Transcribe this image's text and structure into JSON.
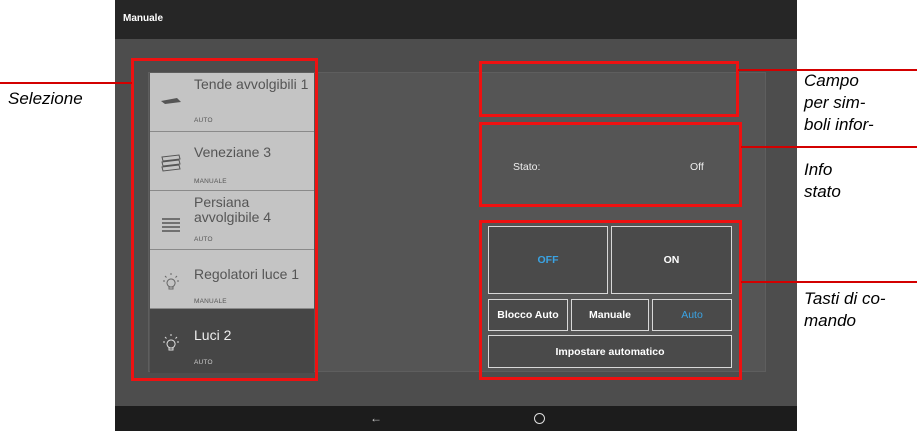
{
  "window": {
    "title": "Manuale"
  },
  "list": {
    "items": [
      {
        "label": "Tende avvolgibili 1",
        "mode": "AUTO",
        "icon": "awning-icon",
        "selected": false
      },
      {
        "label": "Veneziane 3",
        "mode": "MANUALE",
        "icon": "venetian-blind-icon",
        "selected": false
      },
      {
        "label": "Persiana avvolgibile 4",
        "mode": "AUTO",
        "icon": "roller-shutter-icon",
        "selected": false
      },
      {
        "label": "Regolatori luce 1",
        "mode": "MANUALE",
        "icon": "light-bulb-icon",
        "selected": false
      },
      {
        "label": "Luci 2",
        "mode": "AUTO",
        "icon": "light-bulb-icon",
        "selected": true
      }
    ]
  },
  "status": {
    "label": "Stato:",
    "value": "Off"
  },
  "buttons": {
    "off": "OFF",
    "on": "ON",
    "blocco_auto": "Blocco Auto",
    "manuale": "Manuale",
    "auto": "Auto",
    "impostare": "Impostare automatico"
  },
  "navbar": {
    "back_glyph": "←"
  },
  "annotations": {
    "selezione": "Selezione",
    "campo": [
      "Campo",
      "per sim-",
      "boli infor-"
    ],
    "info": [
      "Info",
      "stato"
    ],
    "tasti": [
      "Tasti di co-",
      "mando"
    ]
  },
  "colors": {
    "accent_blue": "#3aa3e3",
    "callout_red": "#e11111",
    "list_bg": "#c4c4c4",
    "selected_bg": "#464646"
  }
}
